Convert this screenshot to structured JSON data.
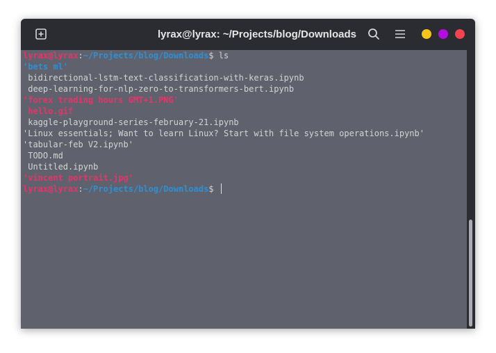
{
  "window": {
    "title": "lyrax@lyrax: ~/Projects/blog/Downloads",
    "icons": {
      "new_tab": "plus-square-icon",
      "search": "magnifier-icon",
      "menu": "hamburger-icon"
    },
    "controls": {
      "minimize_color": "#f5c518",
      "maximize_color": "#b10fe0",
      "close_color": "#f2434e"
    }
  },
  "terminal": {
    "prompt": {
      "user": "lyrax@lyrax",
      "colon": ":",
      "path": "~/Projects/blog/Downloads",
      "dollar": "$ "
    },
    "command": "ls",
    "entries": [
      {
        "text": "'bets ml'",
        "kind": "dir"
      },
      {
        "text": " bidirectional-lstm-text-classification-with-keras.ipynb",
        "kind": "file"
      },
      {
        "text": " deep-learning-for-nlp-zero-to-transformers-bert.ipynb",
        "kind": "file"
      },
      {
        "text": "'forex trading hours GMT+1.PNG'",
        "kind": "img"
      },
      {
        "text": " hello.gif",
        "kind": "img"
      },
      {
        "text": " kaggle-playground-series-february-21.ipynb",
        "kind": "file"
      },
      {
        "text": "'Linux essentials; Want to learn Linux? Start with file system operations.ipynb'",
        "kind": "file"
      },
      {
        "text": "'tabular-feb V2.ipynb'",
        "kind": "file"
      },
      {
        "text": " TODO.md",
        "kind": "file"
      },
      {
        "text": " Untitled.ipynb",
        "kind": "file"
      },
      {
        "text": "'vincent portrait.jpg'",
        "kind": "img"
      }
    ]
  },
  "colors": {
    "titlebar": "#2a2c31",
    "terminal_bg": "#5f626c",
    "prompt_user": "#e8336a",
    "prompt_path": "#2f8fd6",
    "text": "#d4d4d4"
  }
}
